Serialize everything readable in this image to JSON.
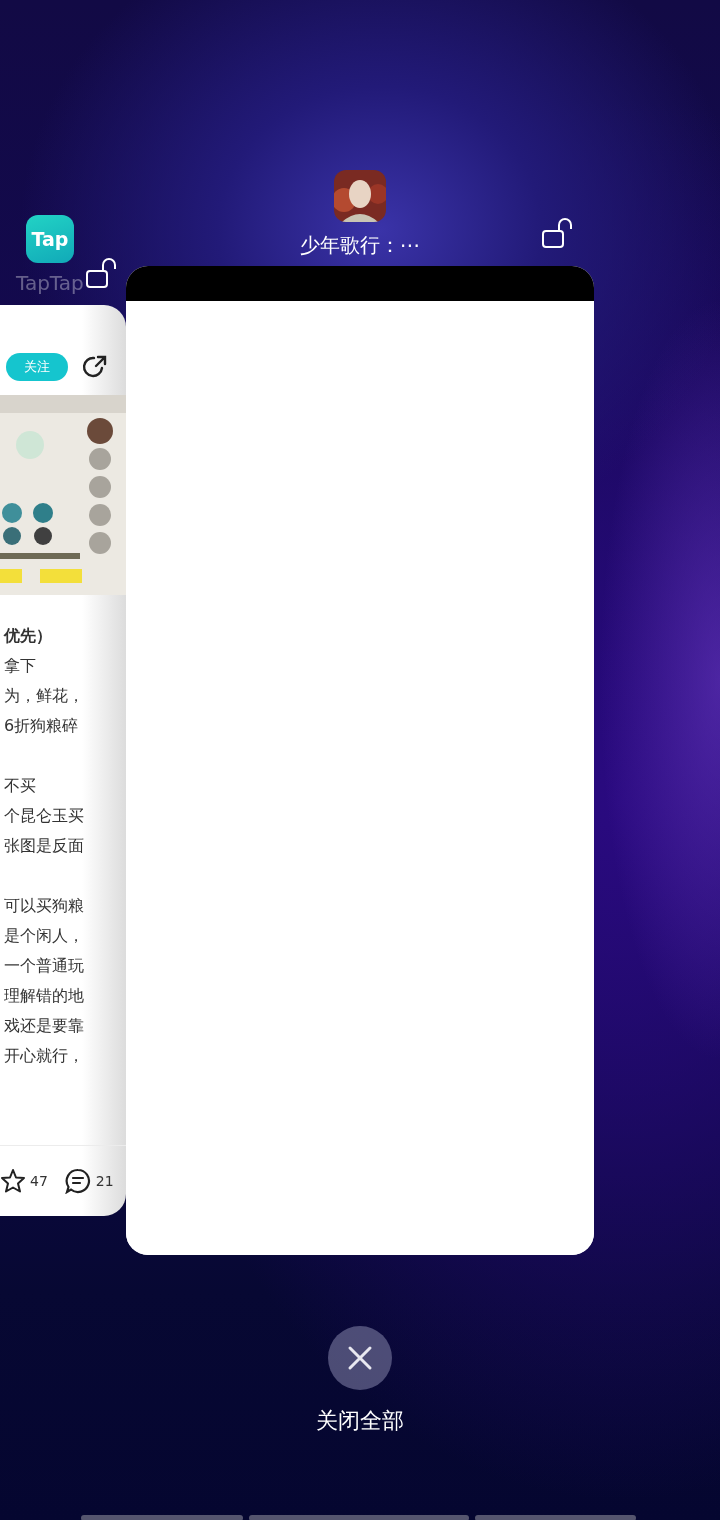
{
  "apps": [
    {
      "kind": "side",
      "name": "TapTap",
      "icon_text": "Tap",
      "locked": false,
      "follow_button": "关注",
      "post_heading": "优先）",
      "post_paragraphs": [
        [
          "拿下",
          "为，鲜花，",
          "6折狗粮碎"
        ],
        [
          "不买",
          "个昆仑玉买",
          "张图是反面"
        ],
        [
          "可以买狗粮",
          "是个闲人，",
          "一个普通玩",
          "理解错的地",
          "戏还是要靠",
          "开心就行，"
        ]
      ],
      "stats": [
        {
          "kind": "star",
          "count": "47"
        },
        {
          "kind": "comment",
          "count": "21"
        }
      ]
    },
    {
      "kind": "main",
      "name": "少年歌行：⋯",
      "locked": false
    }
  ],
  "close_all": {
    "label": "关闭全部"
  }
}
